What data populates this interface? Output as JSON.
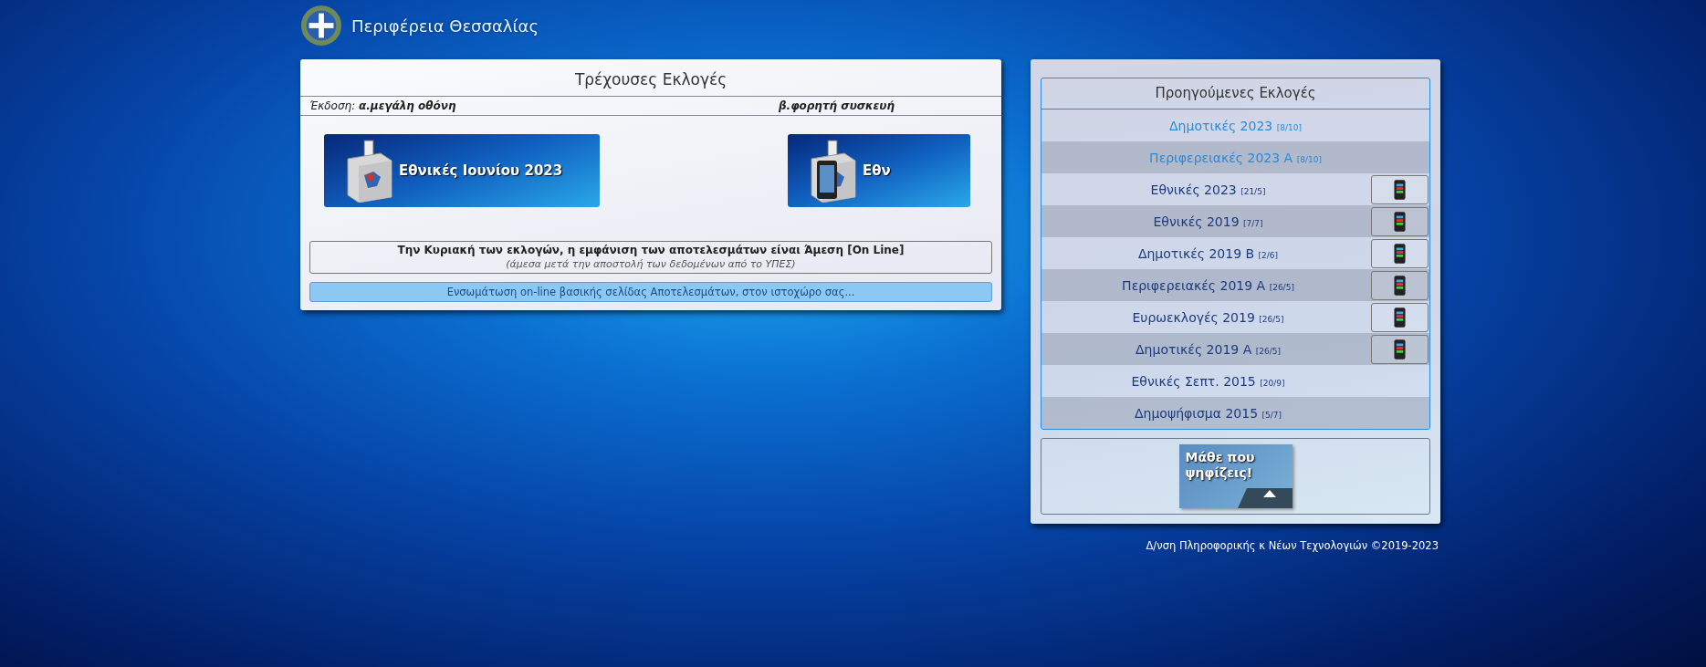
{
  "header": {
    "title": "Περιφέρεια Θεσσαλίας"
  },
  "current": {
    "title": "Τρέχουσες Εκλογές",
    "edition_label": "Έκδοση:",
    "desktop_label": "α.μεγάλη οθόνη",
    "mobile_label": "β.φορητή συσκευή",
    "banners": [
      {
        "kind": "desktop",
        "label": "Εθνικές Ιουνίου 2023"
      },
      {
        "kind": "mobile",
        "label": "Εθν"
      }
    ],
    "notice": {
      "title": "Την Κυριακή των εκλογών, η εμφάνιση των αποτελεσμάτων είναι Άμεση [On Line]",
      "subtitle": "(άμεσα μετά την αποστολή των δεδομένων από το ΥΠΕΣ)"
    },
    "embed_link": "Ενσωμάτωση on-line βασικής σελίδας Αποτελεσμάτων, στον ιστοχώρο σας..."
  },
  "previous": {
    "title": "Προηγούμενες Εκλογές",
    "items": [
      {
        "label": "Δημοτικές 2023",
        "date": "[8/10]",
        "recent": true,
        "mobile": false
      },
      {
        "label": "Περιφερειακές 2023 Α",
        "date": "[8/10]",
        "recent": true,
        "mobile": false
      },
      {
        "label": "Εθνικές 2023",
        "date": "[21/5]",
        "recent": false,
        "mobile": true
      },
      {
        "label": "Εθνικές 2019",
        "date": "[7/7]",
        "recent": false,
        "mobile": true
      },
      {
        "label": "Δημοτικές 2019 Β",
        "date": "[2/6]",
        "recent": false,
        "mobile": true
      },
      {
        "label": "Περιφερειακές 2019 Α",
        "date": "[26/5]",
        "recent": false,
        "mobile": true
      },
      {
        "label": "Ευρωεκλογές 2019",
        "date": "[26/5]",
        "recent": false,
        "mobile": true
      },
      {
        "label": "Δημοτικές 2019 Α",
        "date": "[26/5]",
        "recent": false,
        "mobile": true
      },
      {
        "label": "Εθνικές Σεπτ. 2015",
        "date": "[20/9]",
        "recent": false,
        "mobile": false
      },
      {
        "label": "Δημοψήφισμα 2015",
        "date": "[5/7]",
        "recent": false,
        "mobile": false
      }
    ],
    "find_banner": "Μάθε που ψηφίζεις!"
  },
  "footer": "Δ/νση Πληροφορικής κ Νέων Τεχνολογιών ©2019-2023"
}
